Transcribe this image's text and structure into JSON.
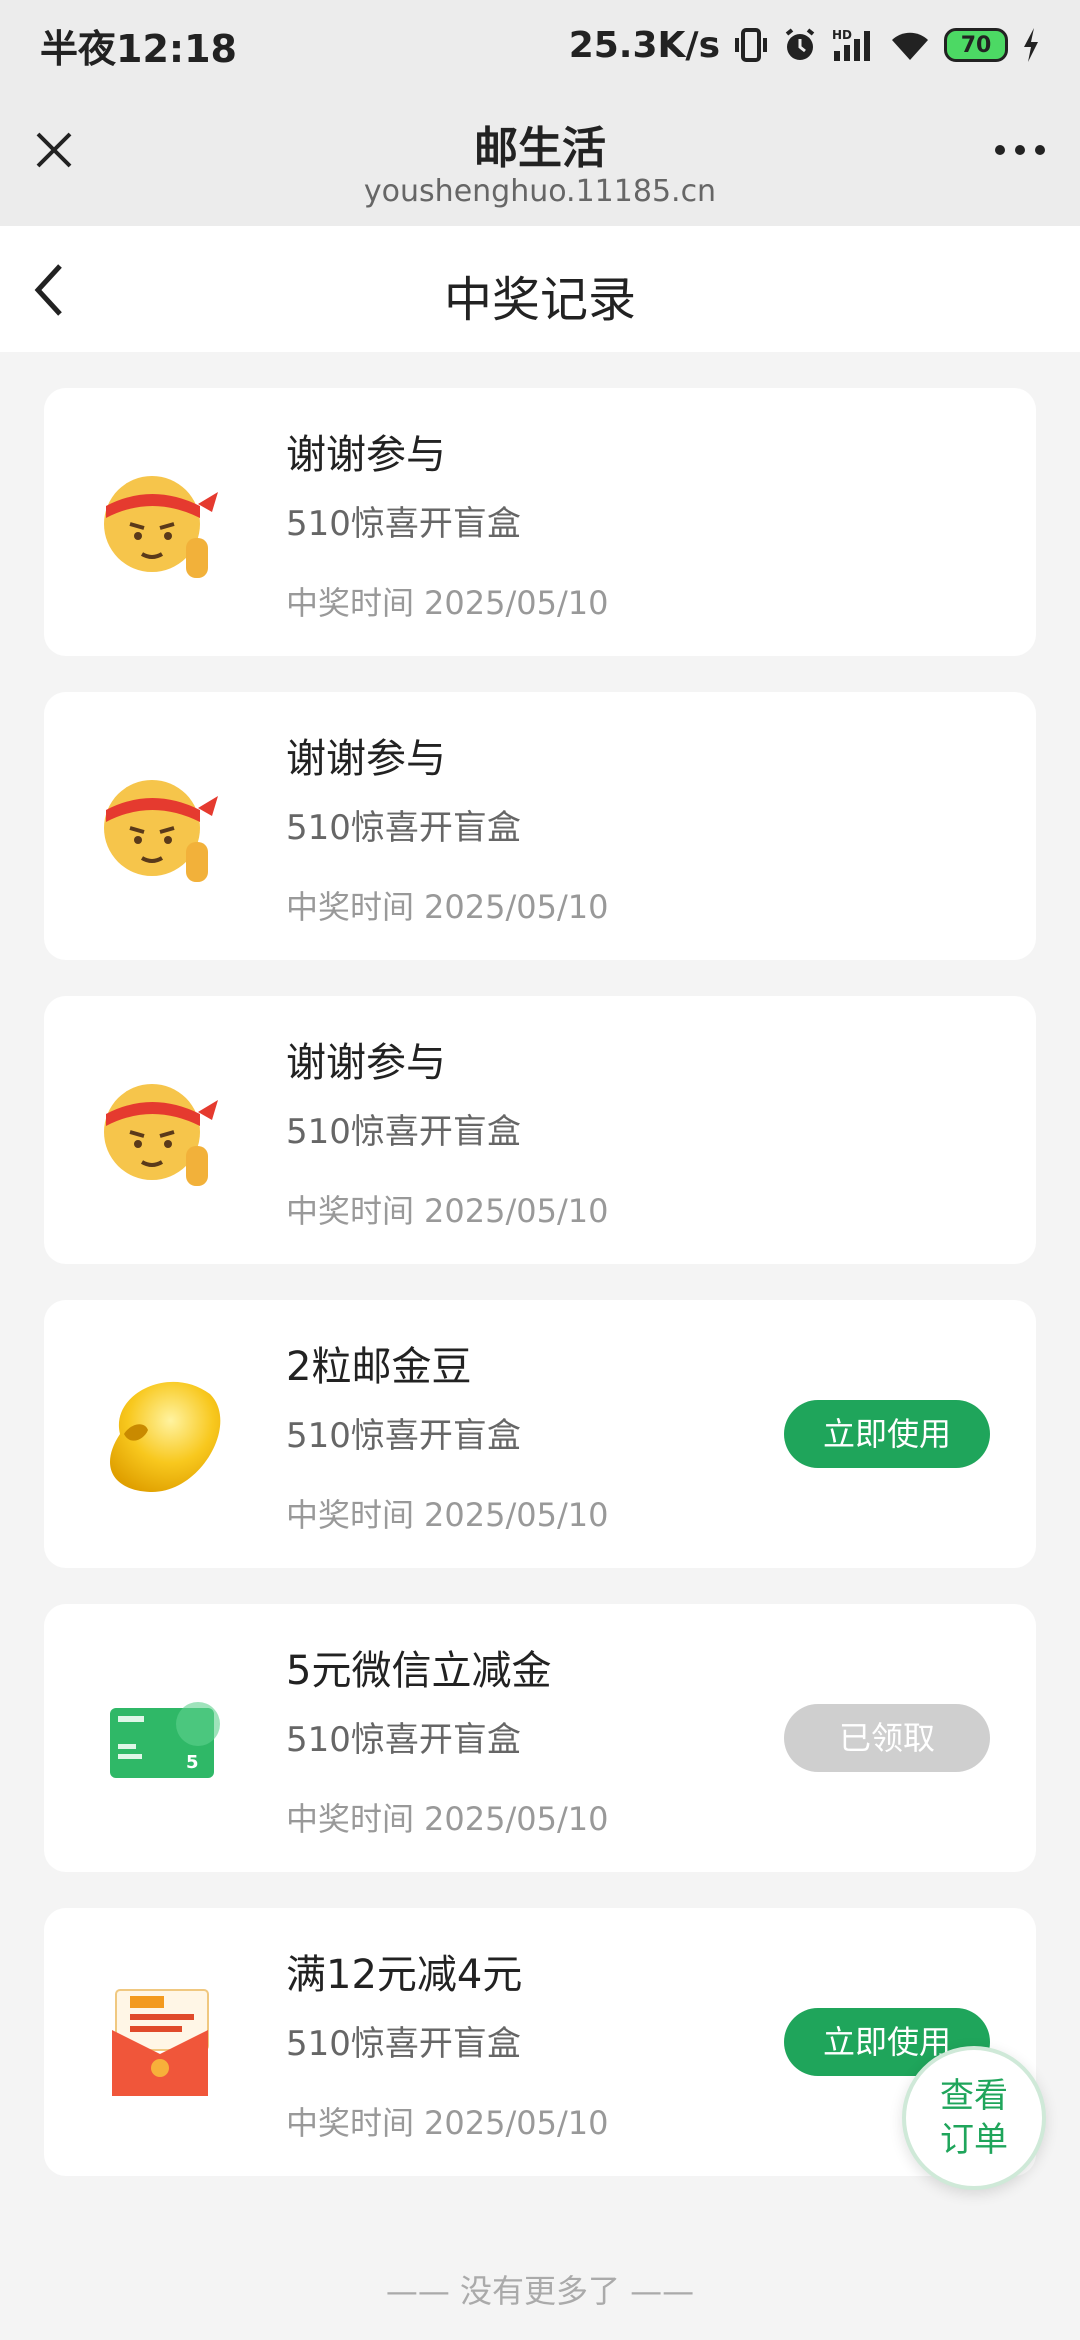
{
  "status_bar": {
    "time": "半夜12:18",
    "speed": "25.3K/s",
    "battery": "70",
    "icons": [
      "vibrate-icon",
      "alarm-icon",
      "hd-signal-icon",
      "wifi-icon",
      "battery-icon",
      "charging-icon"
    ]
  },
  "browser": {
    "title": "邮生活",
    "url": "youshenghuo.11185.cn",
    "close_icon": "close-icon",
    "more_icon": "more-icon"
  },
  "nav": {
    "title": "中奖记录",
    "back_icon": "back-icon"
  },
  "records": [
    {
      "icon": "emoji-thinking-icon",
      "title": "谢谢参与",
      "source": "510惊喜开盲盒",
      "time_label": "中奖时间",
      "time": "2025/05/10",
      "button": ""
    },
    {
      "icon": "emoji-thinking-icon",
      "title": "谢谢参与",
      "source": "510惊喜开盲盒",
      "time_label": "中奖时间",
      "time": "2025/05/10",
      "button": ""
    },
    {
      "icon": "emoji-thinking-icon",
      "title": "谢谢参与",
      "source": "510惊喜开盲盒",
      "time_label": "中奖时间",
      "time": "2025/05/10",
      "button": ""
    },
    {
      "icon": "gold-bean-icon",
      "title": "2粒邮金豆",
      "source": "510惊喜开盲盒",
      "time_label": "中奖时间",
      "time": "2025/05/10",
      "button": "立即使用"
    },
    {
      "icon": "wechat-coupon-icon",
      "title": "5元微信立减金",
      "source": "510惊喜开盲盒",
      "time_label": "中奖时间",
      "time": "2025/05/10",
      "button": "已领取"
    },
    {
      "icon": "ems-red-packet-icon",
      "title": "满12元减4元",
      "source": "510惊喜开盲盒",
      "time_label": "中奖时间",
      "time": "2025/05/10",
      "button": "立即使用"
    }
  ],
  "footer": {
    "end_text": "—— 没有更多了 ——",
    "fab_line1": "查看",
    "fab_line2": "订单"
  },
  "colors": {
    "accent": "#1fa55b",
    "disabled": "#cfcfcf",
    "background": "#f4f4f4"
  }
}
